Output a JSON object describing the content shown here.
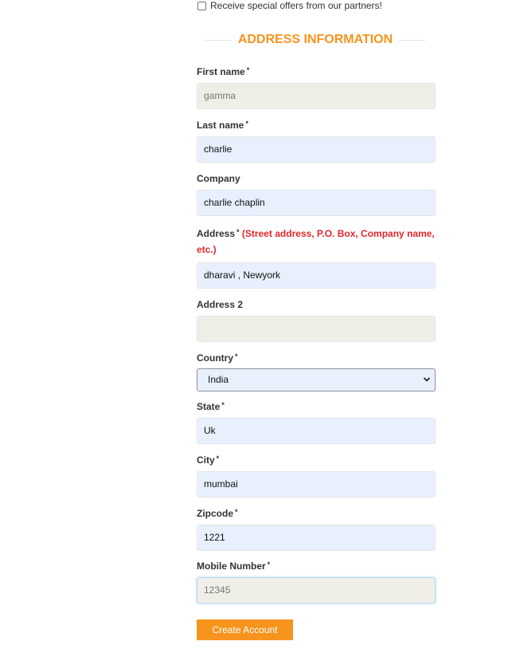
{
  "offers": {
    "label": "Receive special offers from our partners!",
    "checked": false
  },
  "section": {
    "title": "ADDRESS INFORMATION"
  },
  "fields": {
    "first_name": {
      "label": "First name",
      "value": "gamma"
    },
    "last_name": {
      "label": "Last name",
      "value": "charlie"
    },
    "company": {
      "label": "Company",
      "value": "charlie chaplin"
    },
    "address": {
      "label": "Address",
      "hint": "(Street address, P.O. Box, Company name, etc.)",
      "value": "dharavi , Newyork"
    },
    "address2": {
      "label": "Address 2",
      "value": ""
    },
    "country": {
      "label": "Country",
      "value": "India"
    },
    "state": {
      "label": "State",
      "value": "Uk"
    },
    "city": {
      "label": "City",
      "value": "mumbai"
    },
    "zipcode": {
      "label": "Zipcode",
      "value": "1221"
    },
    "mobile": {
      "label": "Mobile Number",
      "value": "12345"
    }
  },
  "required_marker": "*",
  "submit": {
    "label": "Create Account"
  },
  "colors": {
    "accent": "#f7941d",
    "hint": "#e3262c",
    "autofill": "#e8f0fe",
    "disabled_input": "#efefe8"
  }
}
